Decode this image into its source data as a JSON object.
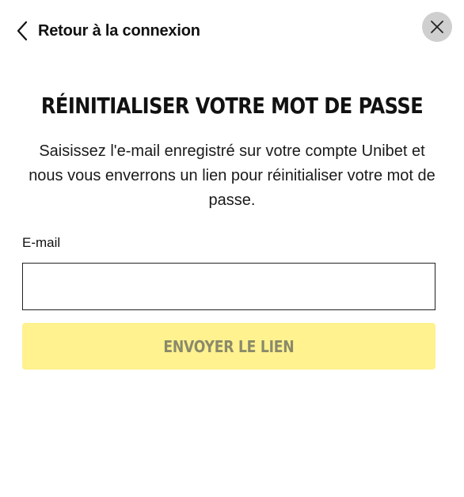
{
  "header": {
    "back_label": "Retour à la connexion",
    "back_icon": "chevron-left-icon",
    "close_icon": "close-icon"
  },
  "main": {
    "title": "RÉINITIALISER VOTRE MOT DE PASSE",
    "description": "Saisissez l'e-mail enregistré sur votre compte Unibet et nous vous enverrons un lien pour réinitialiser votre mot de passe.",
    "email_label": "E-mail",
    "email_value": "",
    "submit_label": "ENVOYER LE LIEN"
  },
  "colors": {
    "button_bg": "#fff28f",
    "button_text": "#8a8a6a",
    "close_bg": "#cfcfcf",
    "text": "#111111"
  }
}
